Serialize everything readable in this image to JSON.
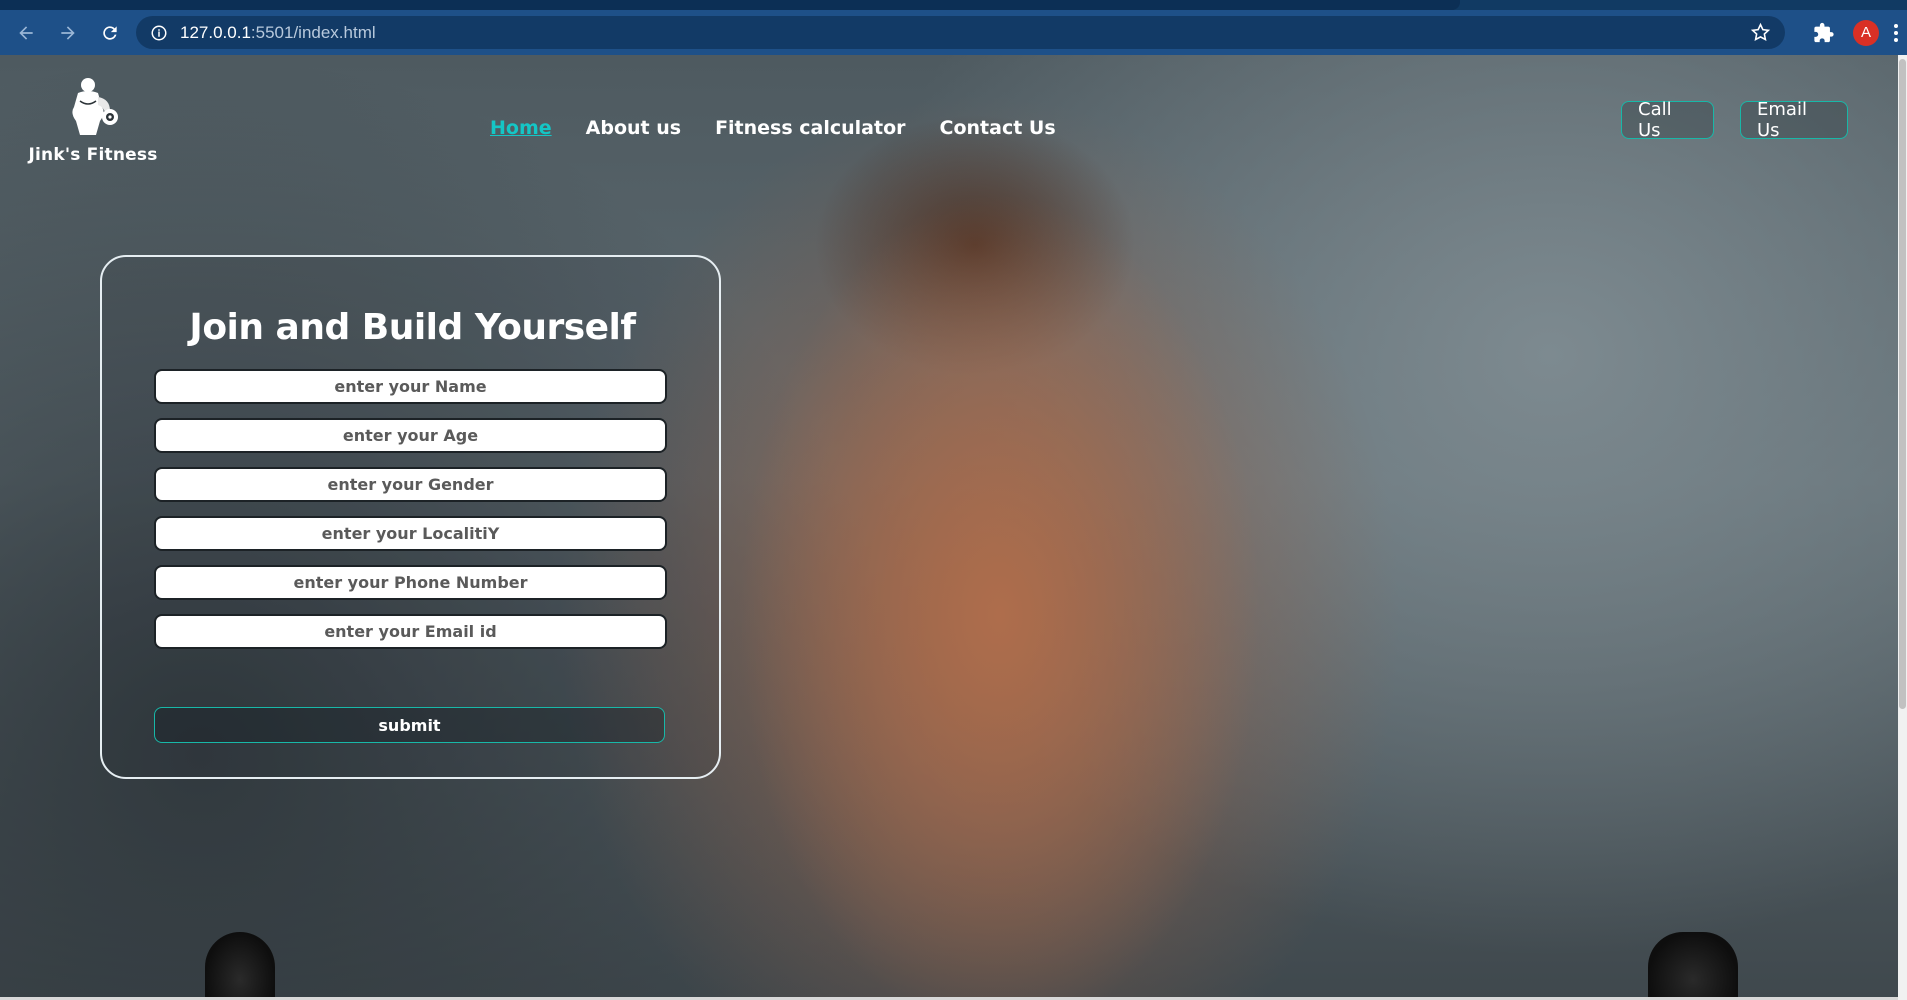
{
  "browser": {
    "url_host": "127.0.0.1",
    "url_path": ":5501/index.html",
    "avatar_letter": "A",
    "icons": [
      "back-icon",
      "forward-icon",
      "reload-icon",
      "info-icon",
      "star-icon",
      "extensions-icon",
      "menu-icon"
    ]
  },
  "site": {
    "brand_name": "Jink's Fitness",
    "nav": [
      {
        "label": "Home",
        "active": true
      },
      {
        "label": "About us",
        "active": false
      },
      {
        "label": "Fitness calculator",
        "active": false
      },
      {
        "label": "Contact Us",
        "active": false
      }
    ],
    "call_label": "Call Us",
    "email_label": "Email Us"
  },
  "form": {
    "title": "Join and Build Yourself",
    "fields": [
      {
        "placeholder": "enter your Name"
      },
      {
        "placeholder": "enter your Age"
      },
      {
        "placeholder": "enter your Gender"
      },
      {
        "placeholder": "enter your LocalitiY"
      },
      {
        "placeholder": "enter your Phone Number"
      },
      {
        "placeholder": "enter your Email id"
      }
    ],
    "submit_label": "submit"
  },
  "colors": {
    "browser_toolbar": "#1e5088",
    "accent": "#14c6c6",
    "button_border": "#18b8a8"
  }
}
